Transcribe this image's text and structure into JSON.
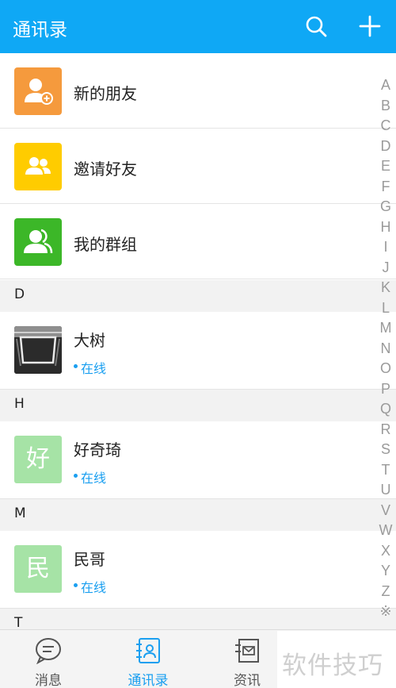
{
  "header": {
    "title": "通讯录",
    "search_icon": "search-icon",
    "add_icon": "plus-icon"
  },
  "fixed_items": [
    {
      "label": "新的朋友",
      "icon": "new-friend-icon",
      "color": "#f59a3d"
    },
    {
      "label": "邀请好友",
      "icon": "invite-friends-icon",
      "color": "#ffcc00"
    },
    {
      "label": "我的群组",
      "icon": "my-groups-icon",
      "color": "#3cb728"
    }
  ],
  "sections": [
    {
      "letter": "D",
      "contacts": [
        {
          "name": "大树",
          "status": "在线",
          "avatar": "photo"
        }
      ]
    },
    {
      "letter": "H",
      "contacts": [
        {
          "name": "好奇琦",
          "status": "在线",
          "avatar_text": "好"
        }
      ]
    },
    {
      "letter": "M",
      "contacts": [
        {
          "name": "民哥",
          "status": "在线",
          "avatar_text": "民"
        }
      ]
    },
    {
      "letter": "T",
      "contacts": []
    }
  ],
  "alphabet": [
    "A",
    "B",
    "C",
    "D",
    "E",
    "F",
    "G",
    "H",
    "I",
    "J",
    "K",
    "L",
    "M",
    "N",
    "O",
    "P",
    "Q",
    "R",
    "S",
    "T",
    "U",
    "V",
    "W",
    "X",
    "Y",
    "Z",
    "※"
  ],
  "tabs": [
    {
      "label": "消息",
      "icon": "message-icon",
      "active": false
    },
    {
      "label": "通讯录",
      "icon": "contacts-icon",
      "active": true
    },
    {
      "label": "资讯",
      "icon": "news-icon",
      "active": false
    }
  ],
  "watermark": "软件技巧",
  "colors": {
    "primary": "#0fa8f5",
    "online": "#1a9ff0"
  }
}
